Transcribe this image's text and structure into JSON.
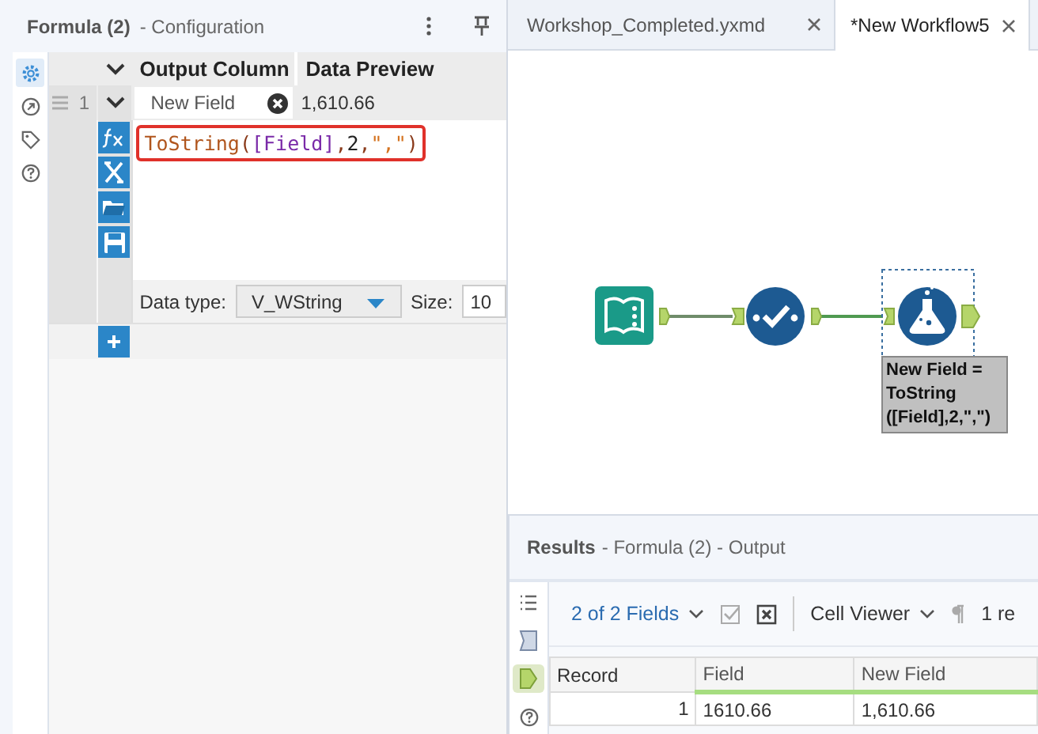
{
  "config_panel": {
    "title": "Formula (2)",
    "subtitle": "- Configuration",
    "rail": [
      {
        "kind": "settings",
        "selected": true
      },
      {
        "kind": "navigate",
        "selected": false
      },
      {
        "kind": "tag",
        "selected": false
      },
      {
        "kind": "help",
        "selected": false
      }
    ],
    "columns": [
      "Output Column",
      "Data Preview"
    ],
    "rows": [
      {
        "number": "1",
        "expanded": true,
        "output_column": "New Field",
        "data_preview": "1,610.66",
        "expression": "ToString([Field],2,\",\")",
        "highlighted": true,
        "data_type_label": "Data type:",
        "data_type": "V_WString",
        "size_label": "Size:",
        "size": "10"
      }
    ]
  },
  "tabs": [
    {
      "label": "Workshop_Completed.yxmd",
      "selected": false
    },
    {
      "label": "*New Workflow5",
      "selected": true
    }
  ],
  "canvas": {
    "annotation": "New Field = ToString ([Field],2,\",\")"
  },
  "results": {
    "title": "Results",
    "subtitle": "- Formula (2) - Output",
    "rail": [
      {
        "kind": "list",
        "selected": false
      },
      {
        "kind": "input-anchor",
        "selected": false
      },
      {
        "kind": "output-anchor",
        "selected": true
      },
      {
        "kind": "help",
        "selected": false
      }
    ],
    "fields_button": "2 of 2 Fields",
    "viewer_button": "Cell Viewer",
    "record_count": "1 re",
    "columns": [
      "Record",
      "Field",
      "New Field"
    ],
    "rows": [
      [
        "1",
        "1610.66",
        "1,610.66"
      ]
    ]
  }
}
